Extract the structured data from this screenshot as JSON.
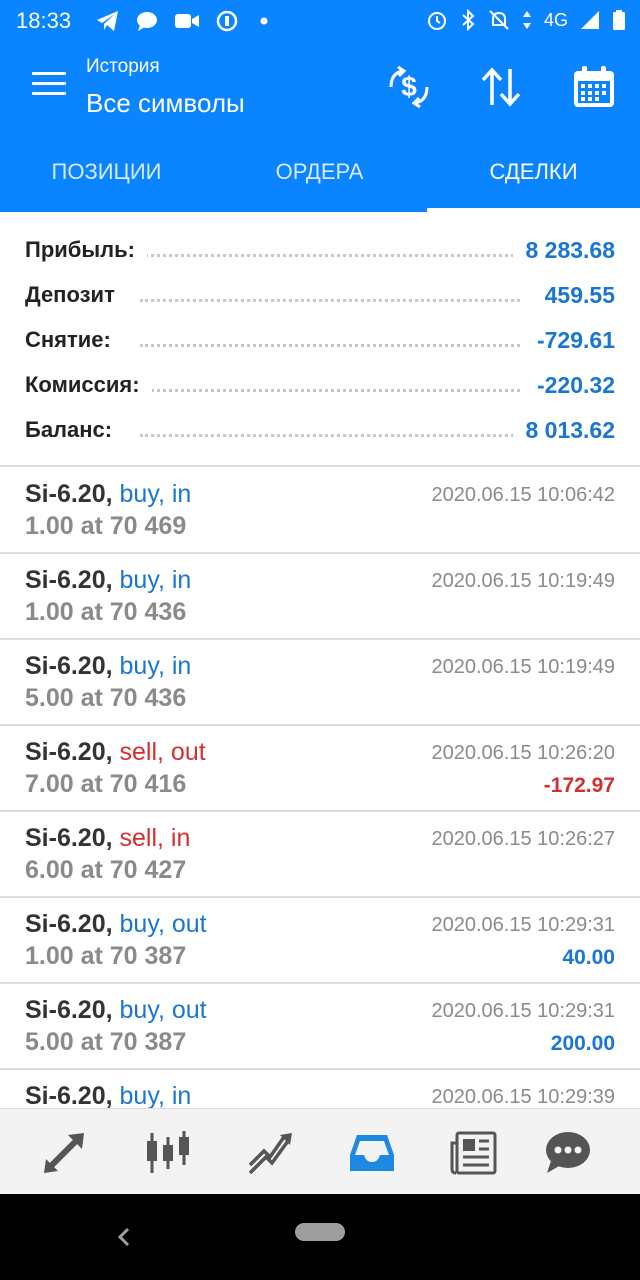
{
  "status_bar": {
    "time": "18:33",
    "network": "4G"
  },
  "header": {
    "subtitle": "История",
    "title": "Все символы"
  },
  "tabs": [
    {
      "label": "ПОЗИЦИИ"
    },
    {
      "label": "ОРДЕРА"
    },
    {
      "label": "СДЕЛКИ"
    }
  ],
  "summary": [
    {
      "label": "Прибыль:",
      "value": "8 283.68"
    },
    {
      "label": "Депозит",
      "value": "459.55"
    },
    {
      "label": "Снятие:",
      "value": "-729.61"
    },
    {
      "label": "Комиссия:",
      "value": "-220.32"
    },
    {
      "label": "Баланс:",
      "value": "8 013.62"
    }
  ],
  "deals": [
    {
      "symbol": "Si-6.20,",
      "direction": "buy, in",
      "volume": "1.00 at 70 469",
      "time": "2020.06.15 10:06:42",
      "profit": ""
    },
    {
      "symbol": "Si-6.20,",
      "direction": "buy, in",
      "volume": "1.00 at 70 436",
      "time": "2020.06.15 10:19:49",
      "profit": ""
    },
    {
      "symbol": "Si-6.20,",
      "direction": "buy, in",
      "volume": "5.00 at 70 436",
      "time": "2020.06.15 10:19:49",
      "profit": ""
    },
    {
      "symbol": "Si-6.20,",
      "direction": "sell, out",
      "volume": "7.00 at 70 416",
      "time": "2020.06.15 10:26:20",
      "profit": "-172.97"
    },
    {
      "symbol": "Si-6.20,",
      "direction": "sell, in",
      "volume": "6.00 at 70 427",
      "time": "2020.06.15 10:26:27",
      "profit": ""
    },
    {
      "symbol": "Si-6.20,",
      "direction": "buy, out",
      "volume": "1.00 at 70 387",
      "time": "2020.06.15 10:29:31",
      "profit": "40.00"
    },
    {
      "symbol": "Si-6.20,",
      "direction": "buy, out",
      "volume": "5.00 at 70 387",
      "time": "2020.06.15 10:29:31",
      "profit": "200.00"
    },
    {
      "symbol": "Si-6.20,",
      "direction": "buy, in",
      "volume": "",
      "time": "2020.06.15 10:29:39",
      "profit": ""
    }
  ],
  "colors": {
    "primary": "#0a84ff",
    "buy": "#1976d2",
    "sell": "#d32f2f",
    "muted": "#8a8a8a"
  },
  "bottom_nav": [
    {
      "icon": "quotes-icon"
    },
    {
      "icon": "chart-icon"
    },
    {
      "icon": "trade-icon"
    },
    {
      "icon": "history-icon"
    },
    {
      "icon": "news-icon"
    },
    {
      "icon": "messages-icon"
    }
  ]
}
